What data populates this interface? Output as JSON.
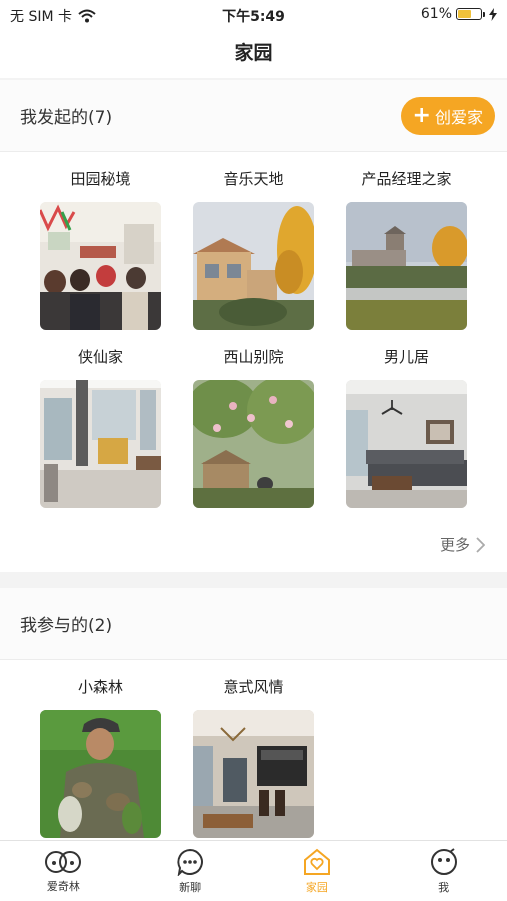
{
  "status": {
    "carrier": "无 SIM 卡",
    "time": "下午5:49",
    "battery": "61%",
    "battery_level": 0.61
  },
  "nav": {
    "title": "家园"
  },
  "initiated": {
    "title": "我发起的(7)",
    "create_label": "创爱家",
    "more_label": "更多",
    "items": [
      {
        "name": "田园秘境"
      },
      {
        "name": "音乐天地"
      },
      {
        "name": "产品经理之家"
      },
      {
        "name": "侠仙家"
      },
      {
        "name": "西山别院"
      },
      {
        "name": "男儿居"
      }
    ]
  },
  "joined": {
    "title": "我参与的(2)",
    "items": [
      {
        "name": "小森林"
      },
      {
        "name": "意式风情"
      }
    ]
  },
  "tabbar": {
    "items": [
      {
        "label": "爱奇林"
      },
      {
        "label": "新聊"
      },
      {
        "label": "家园"
      },
      {
        "label": "我"
      }
    ]
  },
  "colors": {
    "accent": "#f5a623"
  }
}
